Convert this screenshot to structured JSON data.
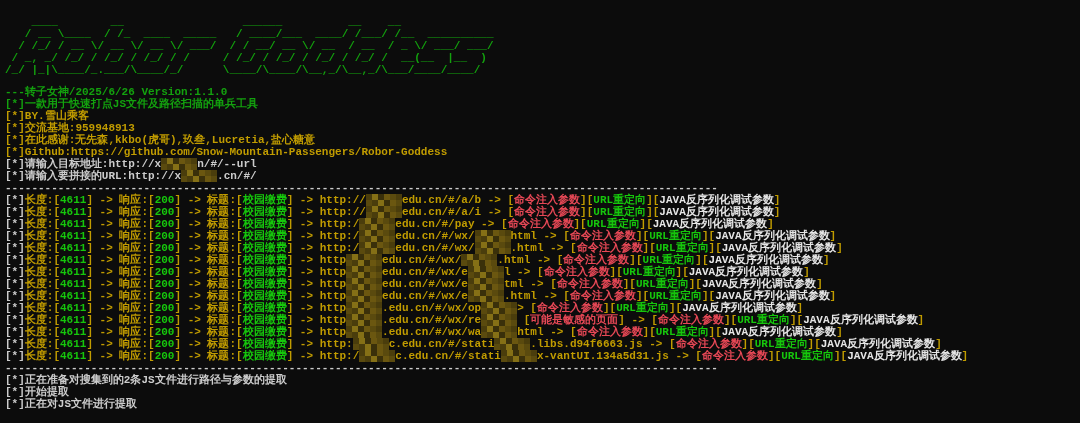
{
  "banner": [
    "    ____        __                  ______          __    __",
    "   / __ \\____  / /_  ____  _____   / ____/___  ____/ /___/ /__  __________",
    "  / /_/ / __ \\/ __ \\/ __ \\/ ___/  / / __/ __ \\/ __  / __  / _ \\/ ___/ ___/",
    " / _, _/ /_/ / /_/ / /_/ / /     / /_/ / /_/ / /_/ / /_/ /  __(__  |__  )",
    "/_/ |_|\\____/_.___/\\____/_/      \\____/\\____/\\__,_/\\__,_/\\___/____/____/"
  ],
  "log": [
    [
      {
        "text": "---转子女神/2025/6/26 Version:1.1.0",
        "color": "#13a10e"
      }
    ],
    [
      {
        "text": "[*]一款用于快速打点JS文件及路径扫描的单兵工具",
        "color": "#13a10e"
      }
    ],
    [
      {
        "text": "[*]BY.雪山乘客",
        "color": "#c19c00"
      }
    ],
    [
      {
        "text": "[*]交流基地:959948913",
        "color": "#c19c00"
      }
    ],
    [
      {
        "text": "[*]在此感谢:无先森,kkbo(虎哥),玖叁,Lucretia,盐心糖意",
        "color": "#c19c00"
      }
    ],
    [
      {
        "text": "[*]Github:https://github.com/Snow-Mountain-Passengers/Robor-Goddess",
        "color": "#c19c00"
      }
    ],
    [
      {
        "text": "[*]请输入目标地址:http://x",
        "color": "#cccccc"
      },
      {
        "kind": "mosaic"
      },
      {
        "text": "n/#/--url",
        "color": "#cccccc"
      }
    ],
    [
      {
        "text": "[*]请输入要拼接的URL:http://x",
        "color": "#cccccc"
      },
      {
        "kind": "mosaic"
      },
      {
        "text": ".cn/#/",
        "color": "#cccccc"
      }
    ],
    [
      {
        "text": "------------------------------------------------------------------------------------------------------------",
        "color": "#cccccc"
      }
    ],
    [
      {
        "text": "[*]",
        "color": "#cccccc"
      },
      {
        "text": "长度:[",
        "color": "#c19c00"
      },
      {
        "text": "4611",
        "color": "#16c60c"
      },
      {
        "text": "] -> 响应:[",
        "color": "#c19c00"
      },
      {
        "text": "200",
        "color": "#16c60c"
      },
      {
        "text": "] -> 标题:[",
        "color": "#c19c00"
      },
      {
        "text": "校园缴费",
        "color": "#16c60c"
      },
      {
        "text": "] -> http://",
        "color": "#c19c00"
      },
      {
        "kind": "mosaic"
      },
      {
        "text": "edu.cn/#/a/b -> [",
        "color": "#c19c00"
      },
      {
        "text": "命令注入参数",
        "color": "#e74856"
      },
      {
        "text": "][",
        "color": "#c19c00"
      },
      {
        "text": "URL重定向",
        "color": "#16c60c"
      },
      {
        "text": "][",
        "color": "#c19c00"
      },
      {
        "text": "JAVA反序列化调试参数",
        "color": "#e6e6e6"
      },
      {
        "text": "]",
        "color": "#c19c00"
      }
    ],
    [
      {
        "text": "[*]",
        "color": "#cccccc"
      },
      {
        "text": "长度:[",
        "color": "#c19c00"
      },
      {
        "text": "4611",
        "color": "#16c60c"
      },
      {
        "text": "] -> 响应:[",
        "color": "#c19c00"
      },
      {
        "text": "200",
        "color": "#16c60c"
      },
      {
        "text": "] -> 标题:[",
        "color": "#c19c00"
      },
      {
        "text": "校园缴费",
        "color": "#16c60c"
      },
      {
        "text": "] -> http://",
        "color": "#c19c00"
      },
      {
        "kind": "mosaic"
      },
      {
        "text": "edu.cn/#/a/i -> [",
        "color": "#c19c00"
      },
      {
        "text": "命令注入参数",
        "color": "#e74856"
      },
      {
        "text": "][",
        "color": "#c19c00"
      },
      {
        "text": "URL重定向",
        "color": "#16c60c"
      },
      {
        "text": "][",
        "color": "#c19c00"
      },
      {
        "text": "JAVA反序列化调试参数",
        "color": "#e6e6e6"
      },
      {
        "text": "]",
        "color": "#c19c00"
      }
    ],
    [
      {
        "text": "[*]",
        "color": "#cccccc"
      },
      {
        "text": "长度:[",
        "color": "#c19c00"
      },
      {
        "text": "4611",
        "color": "#16c60c"
      },
      {
        "text": "] -> 响应:[",
        "color": "#c19c00"
      },
      {
        "text": "200",
        "color": "#16c60c"
      },
      {
        "text": "] -> 标题:[",
        "color": "#c19c00"
      },
      {
        "text": "校园缴费",
        "color": "#16c60c"
      },
      {
        "text": "] -> http:/",
        "color": "#c19c00"
      },
      {
        "kind": "mosaic"
      },
      {
        "text": "edu.cn/#/pay -> [",
        "color": "#c19c00"
      },
      {
        "text": "命令注入参数",
        "color": "#e74856"
      },
      {
        "text": "][",
        "color": "#c19c00"
      },
      {
        "text": "URL重定向",
        "color": "#16c60c"
      },
      {
        "text": "][",
        "color": "#c19c00"
      },
      {
        "text": "JAVA反序列化调试参数",
        "color": "#e6e6e6"
      },
      {
        "text": "]",
        "color": "#c19c00"
      }
    ],
    [
      {
        "text": "[*]",
        "color": "#cccccc"
      },
      {
        "text": "长度:[",
        "color": "#c19c00"
      },
      {
        "text": "4611",
        "color": "#16c60c"
      },
      {
        "text": "] -> 响应:[",
        "color": "#c19c00"
      },
      {
        "text": "200",
        "color": "#16c60c"
      },
      {
        "text": "] -> 标题:[",
        "color": "#c19c00"
      },
      {
        "text": "校园缴费",
        "color": "#16c60c"
      },
      {
        "text": "] -> http:/",
        "color": "#c19c00"
      },
      {
        "kind": "mosaic"
      },
      {
        "text": "edu.cn/#/wx/",
        "color": "#c19c00"
      },
      {
        "kind": "mosaic"
      },
      {
        "text": "html -> [",
        "color": "#c19c00"
      },
      {
        "text": "命令注入参数",
        "color": "#e74856"
      },
      {
        "text": "][",
        "color": "#c19c00"
      },
      {
        "text": "URL重定向",
        "color": "#16c60c"
      },
      {
        "text": "][",
        "color": "#c19c00"
      },
      {
        "text": "JAVA反序列化调试参数",
        "color": "#e6e6e6"
      },
      {
        "text": "]",
        "color": "#c19c00"
      }
    ],
    [
      {
        "text": "[*]",
        "color": "#cccccc"
      },
      {
        "text": "长度:[",
        "color": "#c19c00"
      },
      {
        "text": "4611",
        "color": "#16c60c"
      },
      {
        "text": "] -> 响应:[",
        "color": "#c19c00"
      },
      {
        "text": "200",
        "color": "#16c60c"
      },
      {
        "text": "] -> 标题:[",
        "color": "#c19c00"
      },
      {
        "text": "校园缴费",
        "color": "#16c60c"
      },
      {
        "text": "] -> http:/",
        "color": "#c19c00"
      },
      {
        "kind": "mosaic"
      },
      {
        "text": "edu.cn/#/wx/",
        "color": "#c19c00"
      },
      {
        "kind": "mosaic"
      },
      {
        "text": ".html -> [",
        "color": "#c19c00"
      },
      {
        "text": "命令注入参数",
        "color": "#e74856"
      },
      {
        "text": "][",
        "color": "#c19c00"
      },
      {
        "text": "URL重定向",
        "color": "#16c60c"
      },
      {
        "text": "][",
        "color": "#c19c00"
      },
      {
        "text": "JAVA反序列化调试参数",
        "color": "#e6e6e6"
      },
      {
        "text": "]",
        "color": "#c19c00"
      }
    ],
    [
      {
        "text": "[*]",
        "color": "#cccccc"
      },
      {
        "text": "长度:[",
        "color": "#c19c00"
      },
      {
        "text": "4611",
        "color": "#16c60c"
      },
      {
        "text": "] -> 响应:[",
        "color": "#c19c00"
      },
      {
        "text": "200",
        "color": "#16c60c"
      },
      {
        "text": "] -> 标题:[",
        "color": "#c19c00"
      },
      {
        "text": "校园缴费",
        "color": "#16c60c"
      },
      {
        "text": "] -> http",
        "color": "#c19c00"
      },
      {
        "kind": "mosaic"
      },
      {
        "text": "edu.cn/#/wx/",
        "color": "#c19c00"
      },
      {
        "kind": "mosaic"
      },
      {
        "text": ".html -> [",
        "color": "#c19c00"
      },
      {
        "text": "命令注入参数",
        "color": "#e74856"
      },
      {
        "text": "][",
        "color": "#c19c00"
      },
      {
        "text": "URL重定向",
        "color": "#16c60c"
      },
      {
        "text": "][",
        "color": "#c19c00"
      },
      {
        "text": "JAVA反序列化调试参数",
        "color": "#e6e6e6"
      },
      {
        "text": "]",
        "color": "#c19c00"
      }
    ],
    [
      {
        "text": "[*]",
        "color": "#cccccc"
      },
      {
        "text": "长度:[",
        "color": "#c19c00"
      },
      {
        "text": "4611",
        "color": "#16c60c"
      },
      {
        "text": "] -> 响应:[",
        "color": "#c19c00"
      },
      {
        "text": "200",
        "color": "#16c60c"
      },
      {
        "text": "] -> 标题:[",
        "color": "#c19c00"
      },
      {
        "text": "校园缴费",
        "color": "#16c60c"
      },
      {
        "text": "] -> http",
        "color": "#c19c00"
      },
      {
        "kind": "mosaic"
      },
      {
        "text": "edu.cn/#/wx/e",
        "color": "#c19c00"
      },
      {
        "kind": "mosaic"
      },
      {
        "text": "l -> [",
        "color": "#c19c00"
      },
      {
        "text": "命令注入参数",
        "color": "#e74856"
      },
      {
        "text": "][",
        "color": "#c19c00"
      },
      {
        "text": "URL重定向",
        "color": "#16c60c"
      },
      {
        "text": "][",
        "color": "#c19c00"
      },
      {
        "text": "JAVA反序列化调试参数",
        "color": "#e6e6e6"
      },
      {
        "text": "]",
        "color": "#c19c00"
      }
    ],
    [
      {
        "text": "[*]",
        "color": "#cccccc"
      },
      {
        "text": "长度:[",
        "color": "#c19c00"
      },
      {
        "text": "4611",
        "color": "#16c60c"
      },
      {
        "text": "] -> 响应:[",
        "color": "#c19c00"
      },
      {
        "text": "200",
        "color": "#16c60c"
      },
      {
        "text": "] -> 标题:[",
        "color": "#c19c00"
      },
      {
        "text": "校园缴费",
        "color": "#16c60c"
      },
      {
        "text": "] -> http",
        "color": "#c19c00"
      },
      {
        "kind": "mosaic"
      },
      {
        "text": "edu.cn/#/wx/e",
        "color": "#c19c00"
      },
      {
        "kind": "mosaic"
      },
      {
        "text": "tml -> [",
        "color": "#c19c00"
      },
      {
        "text": "命令注入参数",
        "color": "#e74856"
      },
      {
        "text": "][",
        "color": "#c19c00"
      },
      {
        "text": "URL重定向",
        "color": "#16c60c"
      },
      {
        "text": "][",
        "color": "#c19c00"
      },
      {
        "text": "JAVA反序列化调试参数",
        "color": "#e6e6e6"
      },
      {
        "text": "]",
        "color": "#c19c00"
      }
    ],
    [
      {
        "text": "[*]",
        "color": "#cccccc"
      },
      {
        "text": "长度:[",
        "color": "#c19c00"
      },
      {
        "text": "4611",
        "color": "#16c60c"
      },
      {
        "text": "] -> 响应:[",
        "color": "#c19c00"
      },
      {
        "text": "200",
        "color": "#16c60c"
      },
      {
        "text": "] -> 标题:[",
        "color": "#c19c00"
      },
      {
        "text": "校园缴费",
        "color": "#16c60c"
      },
      {
        "text": "] -> http",
        "color": "#c19c00"
      },
      {
        "kind": "mosaic"
      },
      {
        "text": "edu.cn/#/wx/e",
        "color": "#c19c00"
      },
      {
        "kind": "mosaic"
      },
      {
        "text": ".html -> [",
        "color": "#c19c00"
      },
      {
        "text": "命令注入参数",
        "color": "#e74856"
      },
      {
        "text": "][",
        "color": "#c19c00"
      },
      {
        "text": "URL重定向",
        "color": "#16c60c"
      },
      {
        "text": "][",
        "color": "#c19c00"
      },
      {
        "text": "JAVA反序列化调试参数",
        "color": "#e6e6e6"
      },
      {
        "text": "]",
        "color": "#c19c00"
      }
    ],
    [
      {
        "text": "[*]",
        "color": "#cccccc"
      },
      {
        "text": "长度:[",
        "color": "#c19c00"
      },
      {
        "text": "4611",
        "color": "#16c60c"
      },
      {
        "text": "] -> 响应:[",
        "color": "#c19c00"
      },
      {
        "text": "200",
        "color": "#16c60c"
      },
      {
        "text": "] -> 标题:[",
        "color": "#c19c00"
      },
      {
        "text": "校园缴费",
        "color": "#16c60c"
      },
      {
        "text": "] -> http",
        "color": "#c19c00"
      },
      {
        "kind": "mosaic"
      },
      {
        "text": ".edu.cn/#/wx/op",
        "color": "#c19c00"
      },
      {
        "kind": "mosaic"
      },
      {
        "text": "> [",
        "color": "#c19c00"
      },
      {
        "text": "命令注入参数",
        "color": "#e74856"
      },
      {
        "text": "][",
        "color": "#c19c00"
      },
      {
        "text": "URL重定向",
        "color": "#16c60c"
      },
      {
        "text": "][",
        "color": "#c19c00"
      },
      {
        "text": "JAVA反序列化调试参数",
        "color": "#e6e6e6"
      },
      {
        "text": "]",
        "color": "#c19c00"
      }
    ],
    [
      {
        "text": "[*]",
        "color": "#cccccc"
      },
      {
        "text": "长度:[",
        "color": "#c19c00"
      },
      {
        "text": "4611",
        "color": "#16c60c"
      },
      {
        "text": "] -> 响应:[",
        "color": "#c19c00"
      },
      {
        "text": "200",
        "color": "#16c60c"
      },
      {
        "text": "] -> 标题:[",
        "color": "#c19c00"
      },
      {
        "text": "校园缴费",
        "color": "#16c60c"
      },
      {
        "text": "] -> http",
        "color": "#c19c00"
      },
      {
        "kind": "mosaic"
      },
      {
        "text": ".edu.cn/#/wx/re",
        "color": "#c19c00"
      },
      {
        "kind": "mosaic"
      },
      {
        "text": " [",
        "color": "#c19c00"
      },
      {
        "text": "可能是敏感的页面",
        "color": "#e74856"
      },
      {
        "text": "] -> [",
        "color": "#c19c00"
      },
      {
        "text": "命令注入参数",
        "color": "#e74856"
      },
      {
        "text": "][",
        "color": "#c19c00"
      },
      {
        "text": "URL重定向",
        "color": "#16c60c"
      },
      {
        "text": "][",
        "color": "#c19c00"
      },
      {
        "text": "JAVA反序列化调试参数",
        "color": "#e6e6e6"
      },
      {
        "text": "]",
        "color": "#c19c00"
      }
    ],
    [
      {
        "text": "[*]",
        "color": "#cccccc"
      },
      {
        "text": "长度:[",
        "color": "#c19c00"
      },
      {
        "text": "4611",
        "color": "#16c60c"
      },
      {
        "text": "] -> 响应:[",
        "color": "#c19c00"
      },
      {
        "text": "200",
        "color": "#16c60c"
      },
      {
        "text": "] -> 标题:[",
        "color": "#c19c00"
      },
      {
        "text": "校园缴费",
        "color": "#16c60c"
      },
      {
        "text": "] -> http",
        "color": "#c19c00"
      },
      {
        "kind": "mosaic"
      },
      {
        "text": ".edu.cn/#/wx/wa",
        "color": "#c19c00"
      },
      {
        "kind": "mosaic"
      },
      {
        "text": "html -> [",
        "color": "#c19c00"
      },
      {
        "text": "命令注入参数",
        "color": "#e74856"
      },
      {
        "text": "][",
        "color": "#c19c00"
      },
      {
        "text": "URL重定向",
        "color": "#16c60c"
      },
      {
        "text": "][",
        "color": "#c19c00"
      },
      {
        "text": "JAVA反序列化调试参数",
        "color": "#e6e6e6"
      },
      {
        "text": "]",
        "color": "#c19c00"
      }
    ],
    [
      {
        "text": "[*]",
        "color": "#cccccc"
      },
      {
        "text": "长度:[",
        "color": "#c19c00"
      },
      {
        "text": "4611",
        "color": "#16c60c"
      },
      {
        "text": "] -> 响应:[",
        "color": "#c19c00"
      },
      {
        "text": "200",
        "color": "#16c60c"
      },
      {
        "text": "] -> 标题:[",
        "color": "#c19c00"
      },
      {
        "text": "校园缴费",
        "color": "#16c60c"
      },
      {
        "text": "] -> http:",
        "color": "#c19c00"
      },
      {
        "kind": "mosaic"
      },
      {
        "text": "c.edu.cn/#/stati",
        "color": "#c19c00"
      },
      {
        "kind": "mosaic"
      },
      {
        "text": ".libs.d94f6663.js -> [",
        "color": "#c19c00"
      },
      {
        "text": "命令注入参数",
        "color": "#e74856"
      },
      {
        "text": "][",
        "color": "#c19c00"
      },
      {
        "text": "URL重定向",
        "color": "#16c60c"
      },
      {
        "text": "][",
        "color": "#c19c00"
      },
      {
        "text": "JAVA反序列化调试参数",
        "color": "#e6e6e6"
      },
      {
        "text": "]",
        "color": "#c19c00"
      }
    ],
    [
      {
        "text": "[*]",
        "color": "#cccccc"
      },
      {
        "text": "长度:[",
        "color": "#c19c00"
      },
      {
        "text": "4611",
        "color": "#16c60c"
      },
      {
        "text": "] -> 响应:[",
        "color": "#c19c00"
      },
      {
        "text": "200",
        "color": "#16c60c"
      },
      {
        "text": "] -> 标题:[",
        "color": "#c19c00"
      },
      {
        "text": "校园缴费",
        "color": "#16c60c"
      },
      {
        "text": "] -> http:/",
        "color": "#c19c00"
      },
      {
        "kind": "mosaic"
      },
      {
        "text": "c.edu.cn/#/stati",
        "color": "#c19c00"
      },
      {
        "kind": "mosaic"
      },
      {
        "text": "x-vantUI.134a5d31.js -> [",
        "color": "#c19c00"
      },
      {
        "text": "命令注入参数",
        "color": "#e74856"
      },
      {
        "text": "][",
        "color": "#c19c00"
      },
      {
        "text": "URL重定向",
        "color": "#16c60c"
      },
      {
        "text": "][",
        "color": "#c19c00"
      },
      {
        "text": "JAVA反序列化调试参数",
        "color": "#e6e6e6"
      },
      {
        "text": "]",
        "color": "#c19c00"
      }
    ],
    [
      {
        "text": "------------------------------------------------------------------------------------------------------------",
        "color": "#cccccc"
      }
    ],
    [
      {
        "text": "[*]正在准备对搜集到的2条JS文件进行路径与参数的提取",
        "color": "#cccccc"
      }
    ],
    [
      {
        "text": "[*]开始提取",
        "color": "#cccccc"
      }
    ],
    [
      {
        "text": "[*]正在对JS文件进行提取",
        "color": "#cccccc"
      }
    ]
  ]
}
